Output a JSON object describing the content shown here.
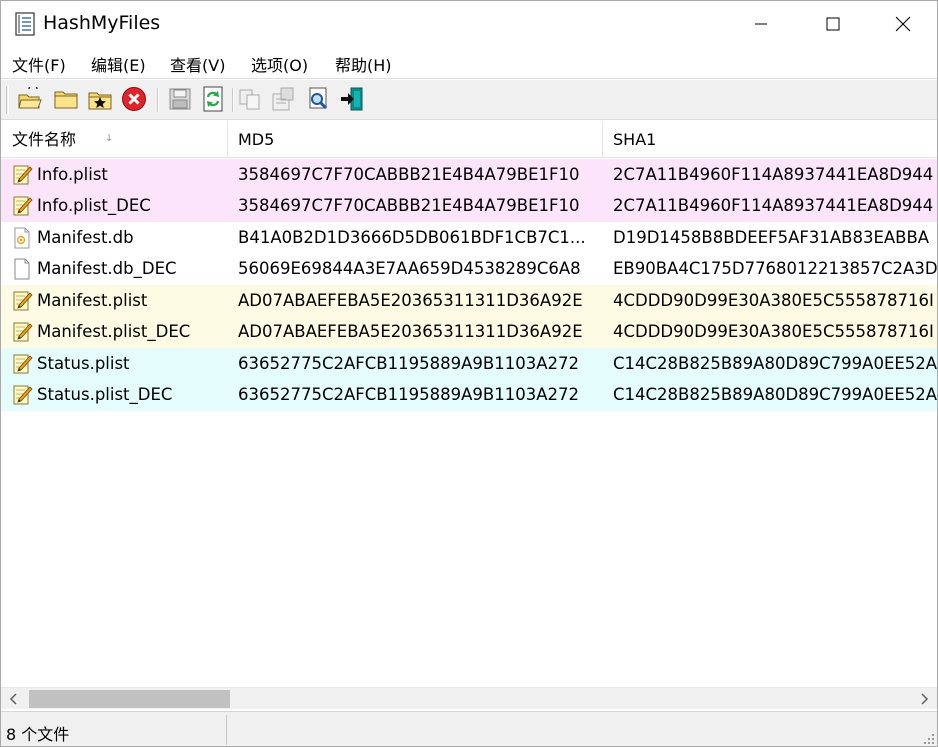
{
  "window": {
    "title": "HashMyFiles"
  },
  "menu": [
    {
      "label": "文件(F)"
    },
    {
      "label": "编辑(E)"
    },
    {
      "label": "查看(V)"
    },
    {
      "label": "选项(O)"
    },
    {
      "label": "帮助(H)"
    }
  ],
  "toolbar": {
    "icons": [
      "open-files-icon",
      "open-folder-icon",
      "add-folder-icon",
      "delete-icon",
      "save-icon",
      "refresh-icon",
      "copy-icon",
      "properties-icon",
      "find-icon",
      "exit-icon"
    ]
  },
  "columns": [
    {
      "label": "文件名称"
    },
    {
      "label": "MD5"
    },
    {
      "label": "SHA1"
    }
  ],
  "colors": {
    "pink": "#fce4fb",
    "white": "#ffffff",
    "yellow": "#fefbe5",
    "cyan": "#e4fcfc"
  },
  "rows": [
    {
      "name": "Info.plist",
      "md5": "3584697C7F70CABBB21E4B4A79BE1F10",
      "sha1": "2C7A11B4960F114A8937441EA8D944",
      "icon": "pencil-document-icon",
      "color": "pink"
    },
    {
      "name": "Info.plist_DEC",
      "md5": "3584697C7F70CABBB21E4B4A79BE1F10",
      "sha1": "2C7A11B4960F114A8937441EA8D944",
      "icon": "pencil-document-icon",
      "color": "pink"
    },
    {
      "name": "Manifest.db",
      "md5": "B41A0B2D1D3666D5DB061BDF1CB7C1...",
      "sha1": "D19D1458B8BDEEF5AF31AB83EABBA",
      "icon": "database-file-icon",
      "color": "white"
    },
    {
      "name": "Manifest.db_DEC",
      "md5": "56069E69844A3E7AA659D4538289C6A8",
      "sha1": "EB90BA4C175D7768012213857C2A3D",
      "icon": "blank-file-icon",
      "color": "white"
    },
    {
      "name": "Manifest.plist",
      "md5": "AD07ABAEFEBA5E20365311311D36A92E",
      "sha1": "4CDDD90D99E30A380E5C555878716I",
      "icon": "pencil-document-icon",
      "color": "yellow"
    },
    {
      "name": "Manifest.plist_DEC",
      "md5": "AD07ABAEFEBA5E20365311311D36A92E",
      "sha1": "4CDDD90D99E30A380E5C555878716I",
      "icon": "pencil-document-icon",
      "color": "yellow"
    },
    {
      "name": "Status.plist",
      "md5": "63652775C2AFCB1195889A9B1103A272",
      "sha1": "C14C28B825B89A80D89C799A0EE52A",
      "icon": "pencil-document-icon",
      "color": "cyan"
    },
    {
      "name": "Status.plist_DEC",
      "md5": "63652775C2AFCB1195889A9B1103A272",
      "sha1": "C14C28B825B89A80D89C799A0EE52A",
      "icon": "pencil-document-icon",
      "color": "cyan"
    }
  ],
  "status": {
    "text": "8 个文件"
  }
}
